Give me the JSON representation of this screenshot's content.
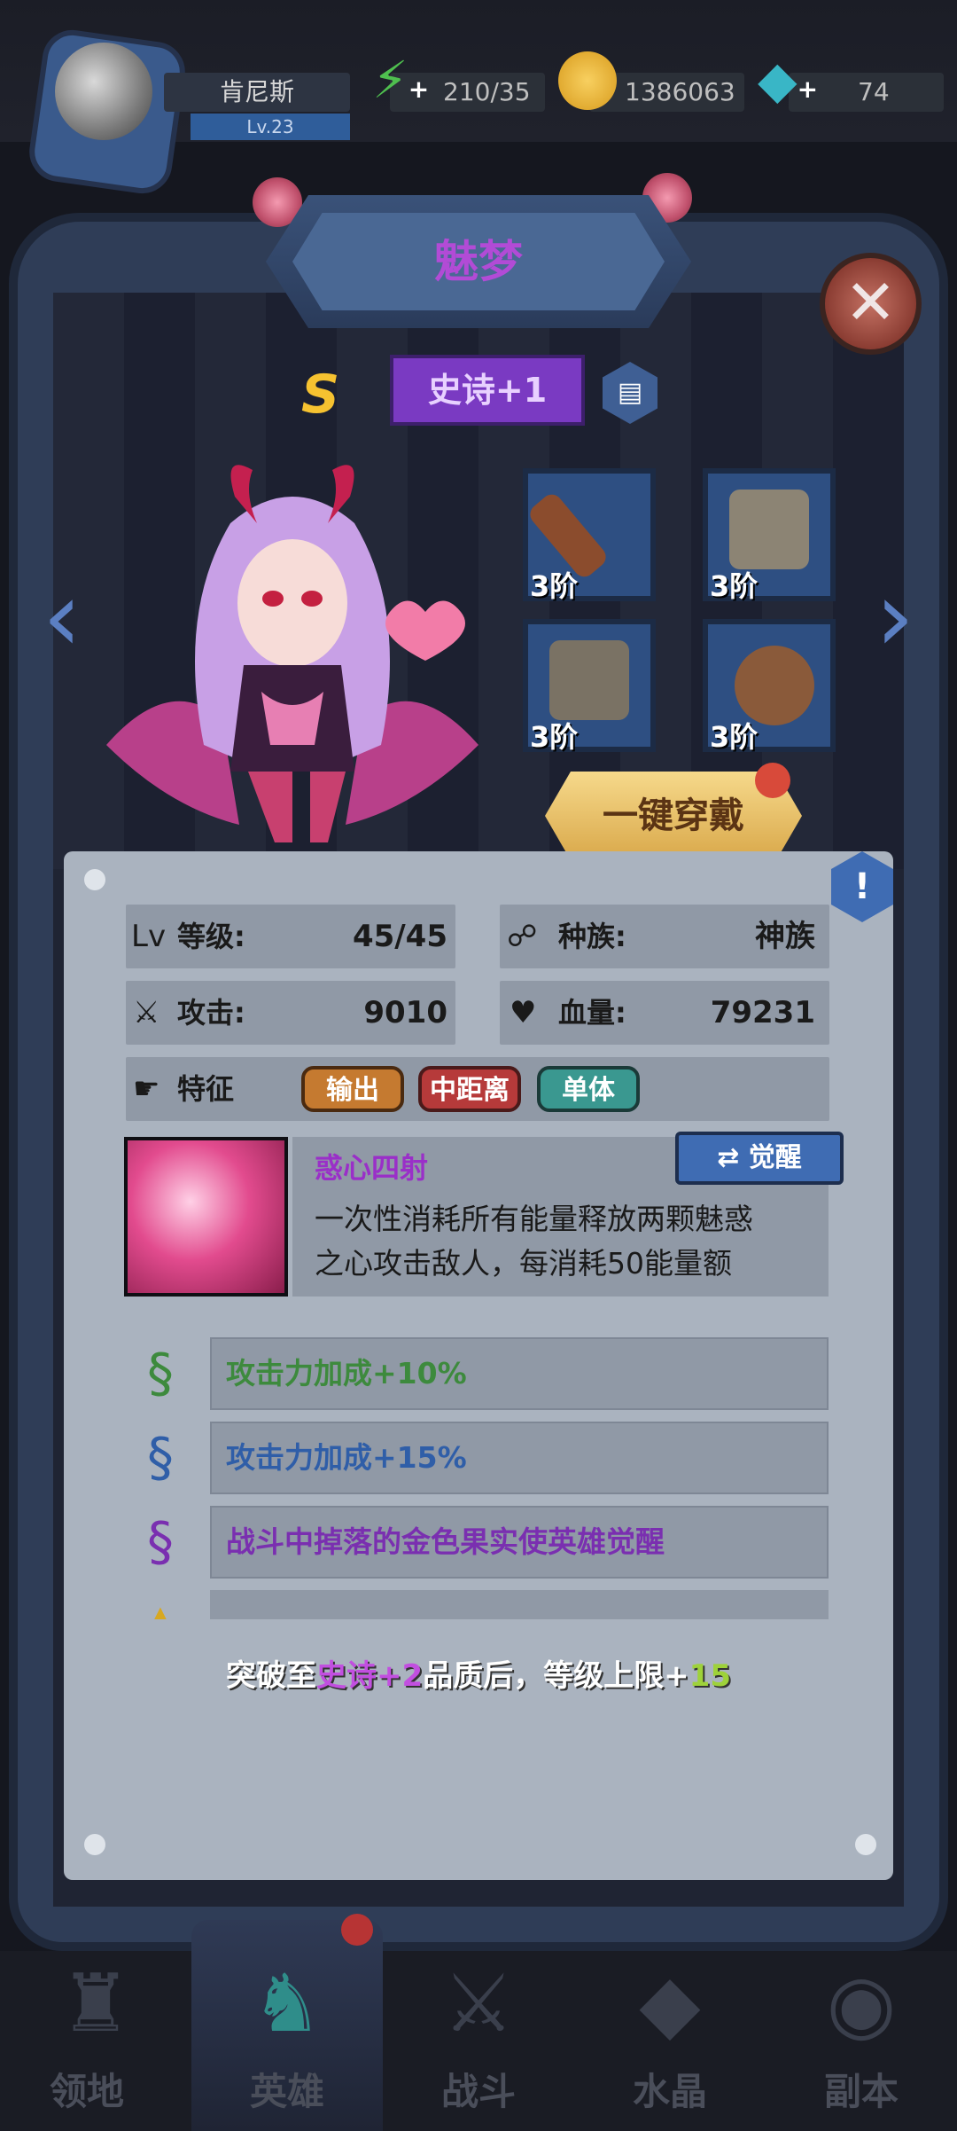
{
  "player": {
    "name": "肯尼斯",
    "level": "Lv.23"
  },
  "resources": {
    "stamina": "210/35",
    "gold": "1386063",
    "gems": "74"
  },
  "hero": {
    "name": "魅梦",
    "grade": "S",
    "rarity": "史诗+1"
  },
  "equipment": [
    {
      "tier": "3阶",
      "icon": "sword-icon"
    },
    {
      "tier": "3阶",
      "icon": "armor-icon"
    },
    {
      "tier": "3阶",
      "icon": "pants-icon"
    },
    {
      "tier": "3阶",
      "icon": "amulet-icon"
    }
  ],
  "wear_all": "一键穿戴",
  "stats": {
    "level_label": "等级:",
    "level_value": "45/45",
    "race_label": "种族:",
    "race_value": "神族",
    "attack_label": "攻击:",
    "attack_value": "9010",
    "hp_label": "血量:",
    "hp_value": "79231",
    "traits_label": "特征",
    "tags": [
      "输出",
      "中距离",
      "单体"
    ]
  },
  "skill": {
    "name": "惑心四射",
    "awaken": "觉醒",
    "description_line1": "一次性消耗所有能量释放两颗魅惑",
    "description_line2": "之心攻击敌人，每消耗50能量额"
  },
  "bonuses": [
    {
      "text": "攻击力加成+10%",
      "color": "#3d8a3d"
    },
    {
      "text": "攻击力加成+15%",
      "color": "#2f5ea8"
    },
    {
      "text": "战斗中掉落的金色果实使英雄觉醒",
      "color": "#7a2fb0"
    }
  ],
  "breakthrough": {
    "prefix": "突破至",
    "rarity": "史诗+2",
    "middle": "品质后，等级上限+",
    "bonus": "15"
  },
  "nav": [
    {
      "label": "领地",
      "icon": "castle-icon"
    },
    {
      "label": "英雄",
      "icon": "hero-icon"
    },
    {
      "label": "战斗",
      "icon": "battle-icon"
    },
    {
      "label": "水晶",
      "icon": "crystal-icon"
    },
    {
      "label": "副本",
      "icon": "dungeon-icon"
    }
  ]
}
